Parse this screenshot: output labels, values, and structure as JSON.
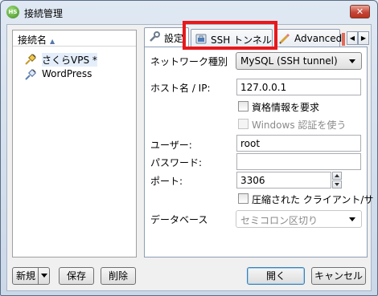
{
  "window": {
    "title": "接続管理",
    "app_icon_text": "HS",
    "close_label": "✕"
  },
  "connections": {
    "header": "接続名",
    "items": [
      {
        "label": "さくらVPS *",
        "icon": "network-plug-icon",
        "selected": true
      },
      {
        "label": "WordPress",
        "icon": "network-plug-icon",
        "selected": false
      }
    ]
  },
  "left_buttons": {
    "new": "新規",
    "save": "保存",
    "delete": "削除"
  },
  "tabs": [
    {
      "label": "設定",
      "icon": "wrench-icon",
      "active": true
    },
    {
      "label": "SSH トンネル",
      "icon": "lock-icon",
      "active": false
    },
    {
      "label": "Advanced",
      "icon": "pencil-icon",
      "active": false
    }
  ],
  "settings": {
    "network_type": {
      "label": "ネットワーク種別",
      "value": "MySQL (SSH tunnel)"
    },
    "host": {
      "label": "ホスト名 / IP:",
      "value": "127.0.0.1"
    },
    "require_credentials": {
      "label": "資格情報を要求",
      "checked": false
    },
    "windows_auth": {
      "label": "Windows 認証を使う",
      "checked": false,
      "disabled": true
    },
    "user": {
      "label": "ユーザー:",
      "value": "root"
    },
    "password": {
      "label": "パスワード:",
      "value": ""
    },
    "port": {
      "label": "ポート:",
      "value": "3306"
    },
    "compressed": {
      "label": "圧縮された クライアント/サ",
      "checked": false
    },
    "database": {
      "label": "データベース",
      "value": "セミコロン区切り",
      "disabled": true
    }
  },
  "bottom_buttons": {
    "open": "開く",
    "cancel": "キャンセル"
  },
  "colors": {
    "highlight": "#e8181b",
    "selection": "#e4eefb"
  }
}
